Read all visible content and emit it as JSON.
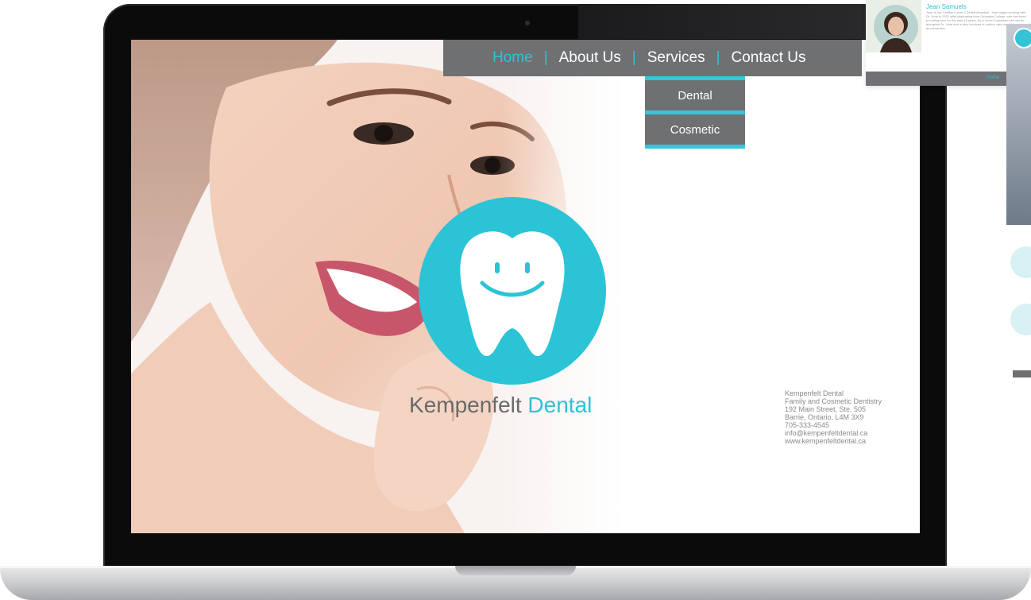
{
  "site": {
    "brand_primary": "Kempenfelt",
    "brand_accent": "Dental",
    "accent_color": "#2bc3d6",
    "nav_color": "#6f7072"
  },
  "nav": {
    "items": [
      {
        "label": "Home",
        "active": true
      },
      {
        "label": "About Us",
        "active": false
      },
      {
        "label": "Services",
        "active": false
      },
      {
        "label": "Contact Us",
        "active": false
      }
    ],
    "separator": "|"
  },
  "dropdown": {
    "items": [
      "Dental",
      "Cosmetic"
    ]
  },
  "contact": {
    "lines": [
      "Kempenfelt Dental",
      "Family and Cosmetic Dentistry",
      "192 Main Street, Ste. 505",
      "Barrie, Ontario, L4M 3X9",
      "705-333-4545",
      "info@kempenfeltdental.ca",
      "www.kempenfeltdental.ca"
    ]
  },
  "profile": {
    "name": "Jean Samuels",
    "bio": "Jean is our Certified Level II Dental Assistant. Jean began working with Dr. June in 2001 after graduating from Georgian College; she has been providing care for the past 15 years. As a Level II assistant she works alongside Dr. June and is also involved in routine care on children as well as preventive",
    "footer": "Home"
  }
}
